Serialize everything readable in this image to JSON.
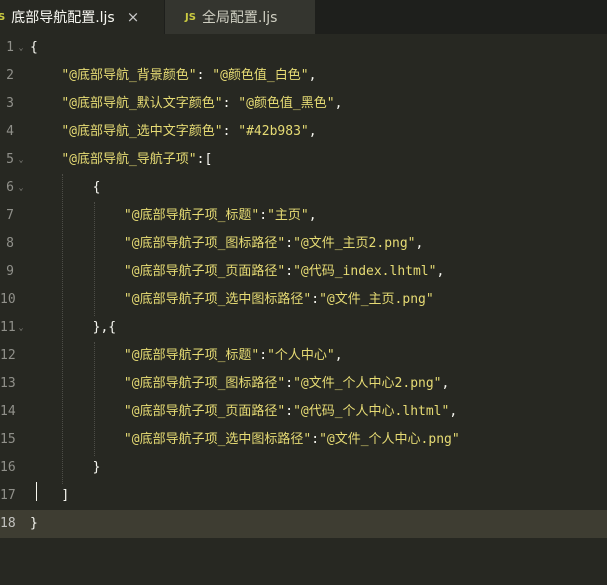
{
  "tabs": [
    {
      "icon": "S",
      "title": "底部导航配置.ljs",
      "close": "×"
    },
    {
      "icon": "JS",
      "title": "全局配置.ljs"
    }
  ],
  "editor": {
    "lines": [
      {
        "n": "1",
        "fold": "⌄",
        "indent": "",
        "tokens": [
          {
            "t": "{",
            "c": "punc"
          }
        ]
      },
      {
        "n": "2",
        "fold": "",
        "indent": "    ",
        "tokens": [
          {
            "t": "\"@底部导航_背景颜色\"",
            "c": "str"
          },
          {
            "t": ": ",
            "c": "punc"
          },
          {
            "t": "\"@颜色值_白色\"",
            "c": "str"
          },
          {
            "t": ",",
            "c": "punc"
          }
        ]
      },
      {
        "n": "3",
        "fold": "",
        "indent": "    ",
        "tokens": [
          {
            "t": "\"@底部导航_默认文字颜色\"",
            "c": "str"
          },
          {
            "t": ": ",
            "c": "punc"
          },
          {
            "t": "\"@颜色值_黑色\"",
            "c": "str"
          },
          {
            "t": ",",
            "c": "punc"
          }
        ]
      },
      {
        "n": "4",
        "fold": "",
        "indent": "    ",
        "tokens": [
          {
            "t": "\"@底部导航_选中文字颜色\"",
            "c": "str"
          },
          {
            "t": ": ",
            "c": "punc"
          },
          {
            "t": "\"#42b983\"",
            "c": "str"
          },
          {
            "t": ",",
            "c": "punc"
          }
        ]
      },
      {
        "n": "5",
        "fold": "⌄",
        "indent": "    ",
        "tokens": [
          {
            "t": "\"@底部导航_导航子项\"",
            "c": "str"
          },
          {
            "t": ":[",
            "c": "punc"
          }
        ]
      },
      {
        "n": "6",
        "fold": "⌄",
        "indent": "        ",
        "tokens": [
          {
            "t": "{",
            "c": "punc"
          }
        ]
      },
      {
        "n": "7",
        "fold": "",
        "indent": "            ",
        "tokens": [
          {
            "t": "\"@底部导航子项_标题\"",
            "c": "str"
          },
          {
            "t": ":",
            "c": "punc"
          },
          {
            "t": "\"主页\"",
            "c": "str"
          },
          {
            "t": ",",
            "c": "punc"
          }
        ]
      },
      {
        "n": "8",
        "fold": "",
        "indent": "            ",
        "tokens": [
          {
            "t": "\"@底部导航子项_图标路径\"",
            "c": "str"
          },
          {
            "t": ":",
            "c": "punc"
          },
          {
            "t": "\"@文件_主页2.png\"",
            "c": "str"
          },
          {
            "t": ",",
            "c": "punc"
          }
        ]
      },
      {
        "n": "9",
        "fold": "",
        "indent": "            ",
        "tokens": [
          {
            "t": "\"@底部导航子项_页面路径\"",
            "c": "str"
          },
          {
            "t": ":",
            "c": "punc"
          },
          {
            "t": "\"@代码_index.lhtml\"",
            "c": "str"
          },
          {
            "t": ",",
            "c": "punc"
          }
        ]
      },
      {
        "n": "10",
        "fold": "",
        "indent": "            ",
        "tokens": [
          {
            "t": "\"@底部导航子项_选中图标路径\"",
            "c": "str"
          },
          {
            "t": ":",
            "c": "punc"
          },
          {
            "t": "\"@文件_主页.png\"",
            "c": "str"
          }
        ]
      },
      {
        "n": "11",
        "fold": "⌄",
        "indent": "        ",
        "tokens": [
          {
            "t": "},{",
            "c": "punc"
          }
        ]
      },
      {
        "n": "12",
        "fold": "",
        "indent": "            ",
        "tokens": [
          {
            "t": "\"@底部导航子项_标题\"",
            "c": "str"
          },
          {
            "t": ":",
            "c": "punc"
          },
          {
            "t": "\"个人中心\"",
            "c": "str"
          },
          {
            "t": ",",
            "c": "punc"
          }
        ]
      },
      {
        "n": "13",
        "fold": "",
        "indent": "            ",
        "tokens": [
          {
            "t": "\"@底部导航子项_图标路径\"",
            "c": "str"
          },
          {
            "t": ":",
            "c": "punc"
          },
          {
            "t": "\"@文件_个人中心2.png\"",
            "c": "str"
          },
          {
            "t": ",",
            "c": "punc"
          }
        ]
      },
      {
        "n": "14",
        "fold": "",
        "indent": "            ",
        "tokens": [
          {
            "t": "\"@底部导航子项_页面路径\"",
            "c": "str"
          },
          {
            "t": ":",
            "c": "punc"
          },
          {
            "t": "\"@代码_个人中心.lhtml\"",
            "c": "str"
          },
          {
            "t": ",",
            "c": "punc"
          }
        ]
      },
      {
        "n": "15",
        "fold": "",
        "indent": "            ",
        "tokens": [
          {
            "t": "\"@底部导航子项_选中图标路径\"",
            "c": "str"
          },
          {
            "t": ":",
            "c": "punc"
          },
          {
            "t": "\"@文件_个人中心.png\"",
            "c": "str"
          }
        ]
      },
      {
        "n": "16",
        "fold": "",
        "indent": "        ",
        "tokens": [
          {
            "t": "}",
            "c": "punc"
          }
        ]
      },
      {
        "n": "17",
        "fold": "",
        "indent": "    ",
        "tokens": [
          {
            "t": "]",
            "c": "punc"
          }
        ]
      },
      {
        "n": "18",
        "fold": "",
        "indent": "",
        "tokens": [
          {
            "t": "}",
            "c": "punc"
          }
        ]
      }
    ],
    "current_line": 18
  }
}
